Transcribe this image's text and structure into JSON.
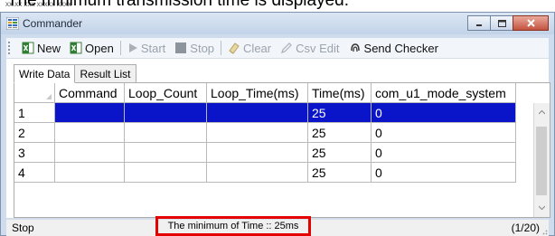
{
  "caption": {
    "text": "The minimum transmission time is displayed.",
    "overline": "xx.xx    xxx  xxxxx  xxxx"
  },
  "window": {
    "title": "Commander",
    "controls": [
      "minimize-button",
      "maximize-button",
      "close-button"
    ]
  },
  "toolbar": {
    "items": [
      {
        "label": "New",
        "icon": "excel-new-icon",
        "enabled": true
      },
      {
        "label": "Open",
        "icon": "excel-open-icon",
        "enabled": true
      },
      {
        "label": "Start",
        "icon": "play-icon",
        "enabled": false
      },
      {
        "label": "Stop",
        "icon": "stop-icon",
        "enabled": false
      },
      {
        "label": "Clear",
        "icon": "eraser-icon",
        "enabled": false
      },
      {
        "label": "Csv Edit",
        "icon": "pencil-icon",
        "enabled": false
      },
      {
        "label": "Send Checker",
        "icon": "antenna-icon",
        "enabled": true
      }
    ]
  },
  "tabs": [
    {
      "label": "Write Data",
      "active": true
    },
    {
      "label": "Result List",
      "active": false
    }
  ],
  "grid": {
    "columns": [
      "",
      "Command",
      "Loop_Count",
      "Loop_Time(ms)",
      "Time(ms)",
      "com_u1_mode_system"
    ],
    "rows": [
      {
        "num": "1",
        "command": "",
        "loop_count": "",
        "loop_time": "",
        "time": "25",
        "mode": "0",
        "selected": true
      },
      {
        "num": "2",
        "command": "",
        "loop_count": "",
        "loop_time": "",
        "time": "25",
        "mode": "0",
        "selected": false
      },
      {
        "num": "3",
        "command": "",
        "loop_count": "",
        "loop_time": "",
        "time": "25",
        "mode": "0",
        "selected": false
      },
      {
        "num": "4",
        "command": "",
        "loop_count": "",
        "loop_time": "",
        "time": "25",
        "mode": "0",
        "selected": false
      }
    ]
  },
  "status": {
    "left": "Stop",
    "message": "The minimum of Time :: 25ms",
    "highlight_color": "#e50000",
    "right": "(1/20)"
  },
  "colors": {
    "selection": "#0a14c8",
    "title_bar": "#cfdced",
    "close_button": "#c45340"
  }
}
